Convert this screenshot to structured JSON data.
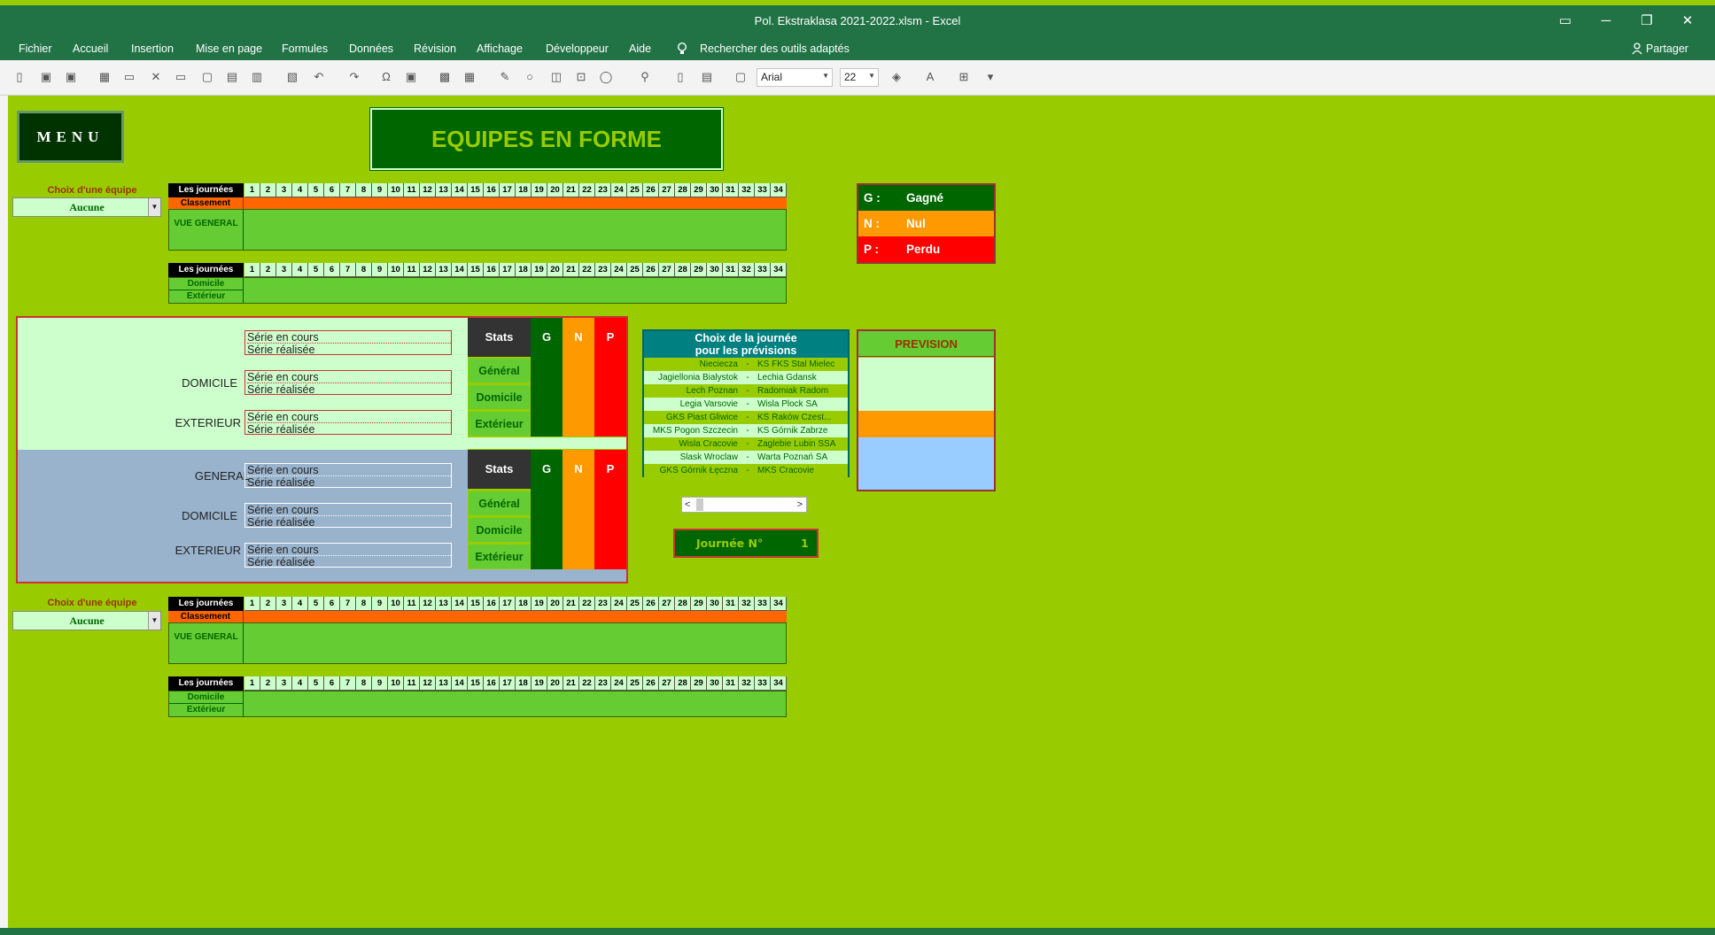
{
  "window": {
    "title": "Pol. Ekstraklasa 2021-2022.xlsm  -  Excel",
    "controls": [
      "▭",
      "─",
      "❐",
      "✕"
    ]
  },
  "menubar": {
    "items": [
      "Fichier",
      "Accueil",
      "Insertion",
      "Mise en page",
      "Formules",
      "Données",
      "Révision",
      "Affichage",
      "Développeur",
      "Aide"
    ],
    "search": "Rechercher des outils adaptés",
    "share": "Partager"
  },
  "toolbar": {
    "font_name": "Arial",
    "font_size": "22"
  },
  "sheet": {
    "menu_button": "MENU",
    "title": "EQUIPES EN FORME",
    "journees": [
      "1",
      "2",
      "3",
      "4",
      "5",
      "6",
      "7",
      "8",
      "9",
      "10",
      "11",
      "12",
      "13",
      "14",
      "15",
      "16",
      "17",
      "18",
      "19",
      "20",
      "21",
      "22",
      "23",
      "24",
      "25",
      "26",
      "27",
      "28",
      "29",
      "30",
      "31",
      "32",
      "33",
      "34"
    ],
    "team_a": {
      "choix_label": "Choix d'une équipe",
      "selected": "Aucune",
      "les_journees": "Les journées",
      "classement": "Classement",
      "vue_general": "VUE GENERAL",
      "domicile": "Domicile",
      "exterieur": "Extérieur"
    },
    "team_b": {
      "choix_label": "Choix d'une équipe",
      "selected": "Aucune",
      "les_journees": "Les journées",
      "classement": "Classement",
      "vue_general": "VUE GENERAL",
      "domicile": "Domicile",
      "exterieur": "Extérieur"
    },
    "legend": [
      {
        "key": "G :",
        "label": "Gagné",
        "color": "#006600"
      },
      {
        "key": "N :",
        "label": "Nul",
        "color": "#ff9900"
      },
      {
        "key": "P :",
        "label": "Perdu",
        "color": "#ff0000"
      }
    ],
    "series": {
      "sections": [
        "GENERAL",
        "DOMICILE",
        "EXTERIEUR"
      ],
      "en_cours": "Série en cours",
      "realisee": "Série réalisée",
      "stats": "Stats",
      "g": "G",
      "n": "N",
      "p": "P",
      "stat_rows": [
        "Général",
        "Domicile",
        "Extérieur"
      ]
    },
    "matches": {
      "header_line1": "Choix de la journée",
      "header_line2": "pour les prévisions",
      "rows": [
        {
          "home": "Niecieczа",
          "away": "KS FKS Stal Mielec"
        },
        {
          "home": "Jagiellonia Bialystok",
          "away": "Lechia Gdansk"
        },
        {
          "home": "Lech Poznan",
          "away": "Radomiak Radom"
        },
        {
          "home": "Legia Varsovie",
          "away": "Wisla Plock SA"
        },
        {
          "home": "GKS Piast Gliwice",
          "away": "KS Raków Czest..."
        },
        {
          "home": "MKS Pogon Szczecin",
          "away": "KS Górnik Zabrze"
        },
        {
          "home": "Wisla Cracovie",
          "away": "Zaglebie Lubin SSA"
        },
        {
          "home": "Slask Wroclaw",
          "away": "Warta Poznań SA"
        },
        {
          "home": "GKS Górnik Łęczna",
          "away": "MKS Cracovie"
        }
      ],
      "separator": "-"
    },
    "journee_label": "Journée N°",
    "journee_value": "1",
    "prevision": "PREVISION"
  }
}
